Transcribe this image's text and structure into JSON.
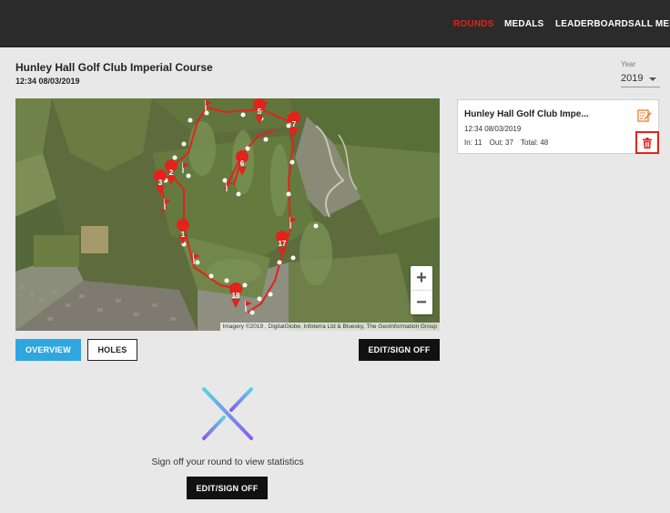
{
  "nav": {
    "rounds": "ROUNDS",
    "medals": "MEDALS",
    "leaderboards": "LEADERBOARDS",
    "all_members": "ALL MEM"
  },
  "round": {
    "course": "Hunley Hall Golf Club Imperial Course",
    "datetime": "12:34 08/03/2019"
  },
  "year_filter": {
    "label": "Year",
    "value": "2019"
  },
  "map": {
    "attribution": "Imagery ©2019 , DigitalGlobe, Infoterra Ltd & Bluesky, The GeoInformation Group",
    "zoom_in": "+",
    "zoom_out": "−",
    "hole_markers": [
      "1",
      "2",
      "3",
      "5",
      "6",
      "7",
      "17",
      "18"
    ]
  },
  "tabs": {
    "overview": "OVERVIEW",
    "holes": "HOLES"
  },
  "actions": {
    "edit_sign_off": "EDIT/SIGN OFF"
  },
  "round_card": {
    "title": "Hunley Hall Golf Club Impe...",
    "datetime": "12:34 08/03/2019",
    "in": "In: 11",
    "out": "Out: 37",
    "total": "Total: 48",
    "edit_icon": "edit-scorecard-icon",
    "delete_icon": "trash-icon"
  },
  "stats": {
    "message": "Sign off your round to view statistics",
    "button": "EDIT/SIGN OFF"
  },
  "colors": {
    "accent_red": "#e2231a",
    "overview_blue": "#2fa6e0",
    "topbar": "#2b2b2b"
  }
}
